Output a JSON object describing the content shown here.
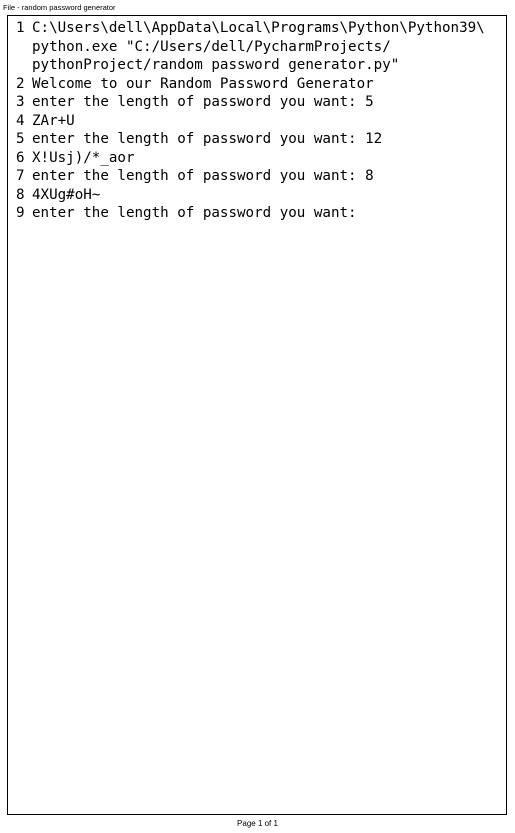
{
  "header": {
    "title": "File - random password generator"
  },
  "console": {
    "lines": [
      {
        "number": "1",
        "text": "C:\\Users\\dell\\AppData\\Local\\Programs\\Python\\Python39\\\npython.exe \"C:/Users/dell/PycharmProjects/\npythonProject/random password generator.py\""
      },
      {
        "number": "2",
        "text": "Welcome to our Random Password Generator"
      },
      {
        "number": "3",
        "text": "enter the length of password you want: 5"
      },
      {
        "number": "4",
        "text": "ZAr+U"
      },
      {
        "number": "5",
        "text": "enter the length of password you want: 12"
      },
      {
        "number": "6",
        "text": "X!Usj)/*_aor"
      },
      {
        "number": "7",
        "text": "enter the length of password you want: 8"
      },
      {
        "number": "8",
        "text": "4XUg#oH~"
      },
      {
        "number": "9",
        "text": "enter the length of password you want: "
      }
    ]
  },
  "footer": {
    "page_label": "Page 1 of 1"
  }
}
